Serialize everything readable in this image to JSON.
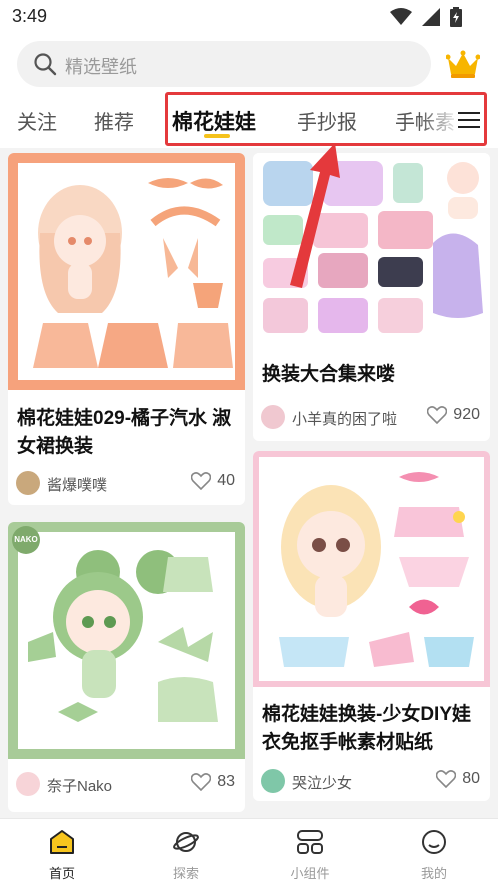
{
  "status_bar": {
    "time": "3:49"
  },
  "search": {
    "placeholder": "精选壁纸"
  },
  "tabs": [
    "关注",
    "推荐",
    "棉花娃娃",
    "手抄报",
    "手帐素"
  ],
  "active_tab": "棉花娃娃",
  "cards": [
    {
      "title": "棉花娃娃029-橘子汽水 淑女裙换装",
      "author": "酱爆噗噗",
      "likes": "40"
    },
    {
      "title": "换装大合集来喽",
      "author": "⁠小羊真的困了啦",
      "likes": "920"
    },
    {
      "title": "",
      "author": "奈子Nako",
      "likes": "83",
      "badge": "NAKO"
    },
    {
      "title": "棉花娃娃换装-少女DIY娃衣免抠手帐素材贴纸",
      "author": "哭泣少女",
      "likes": "80"
    }
  ],
  "bottom_nav": [
    {
      "label": "首页"
    },
    {
      "label": "探索"
    },
    {
      "label": "小组件"
    },
    {
      "label": "我的"
    }
  ],
  "colors": {
    "accent": "#f5c21b",
    "annotation": "#e4393c",
    "card1_border": "#f6a27c",
    "card3_border": "#a8cb98",
    "card4_border": "#f7c6d6"
  }
}
